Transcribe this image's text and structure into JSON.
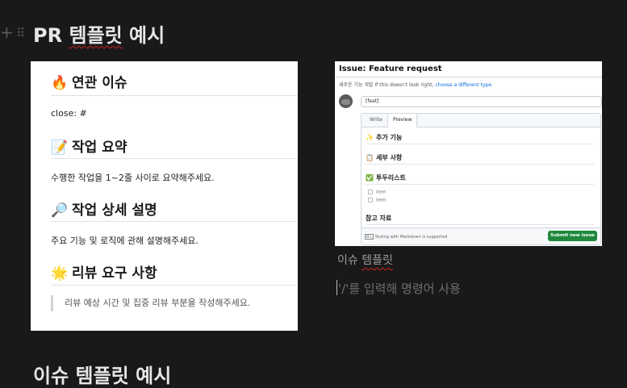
{
  "heading": {
    "prefix": "PR",
    "word1": "템플릿",
    "word2": "예시"
  },
  "next_heading": {
    "text": "이슈 템플릿 예시"
  },
  "block_handles": {
    "plus": "+",
    "drag": "⠿"
  },
  "pr_template": {
    "sections": [
      {
        "emoji": "🔥",
        "title": "연관 이슈"
      },
      {
        "emoji": "📝",
        "title": "작업 요약"
      },
      {
        "emoji": "🔎",
        "title": "작업 상세 설명"
      },
      {
        "emoji": "🌟",
        "title": "리뷰 요구 사항"
      }
    ],
    "close_line": "close: #",
    "summary_text": "수행한 작업을 1~2줄 사이로 요약해주세요.",
    "detail_text": "주요 기능 및 로직에 관해 설명해주세요.",
    "review_quote": "리뷰 예상 시간 및 집중 리뷰 부분을 작성해주세요."
  },
  "issue_template": {
    "title": "Issue: Feature request",
    "note_prefix": "새로운 기능 개발  If this doesn't look right,",
    "note_link": "choose a different type.",
    "title_value": "[feat]",
    "tabs": {
      "write": "Write",
      "preview": "Preview"
    },
    "headings": [
      {
        "emoji": "✨",
        "text": "추가 기능"
      },
      {
        "emoji": "📋",
        "text": "세부 사항"
      },
      {
        "emoji": "✅",
        "text": "투두리스트"
      },
      {
        "emoji": "",
        "text": "참고 자료"
      }
    ],
    "checklist": [
      "item",
      "item"
    ],
    "markdown_badge": "M↓",
    "markdown_note": "Styling with Markdown is supported",
    "submit_label": "Submit new issue"
  },
  "caption": {
    "prefix": "이슈",
    "word": "템플릿"
  },
  "placeholder": "'/'를 입력해 명령어 사용"
}
